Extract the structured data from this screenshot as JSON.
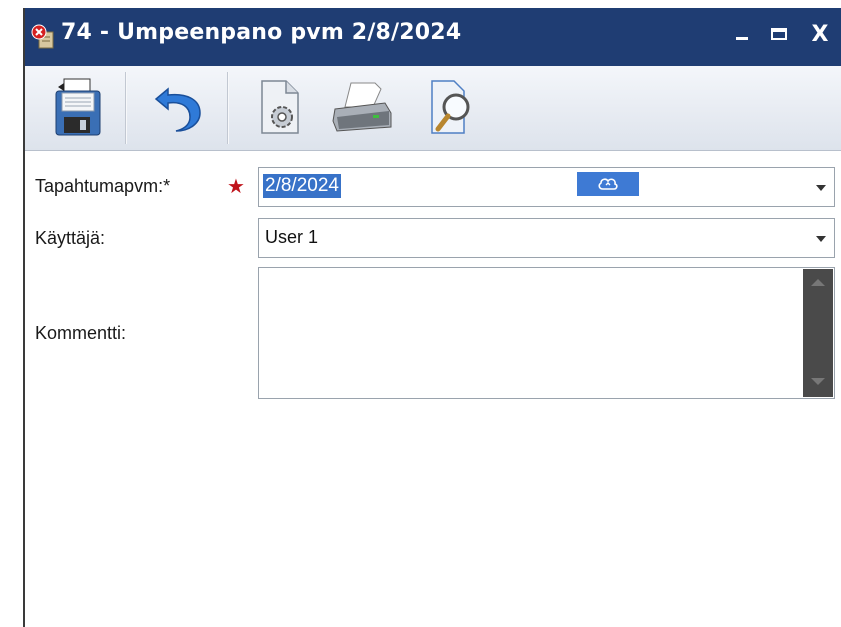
{
  "window": {
    "title": "74 - Umpeenpano pvm 2/8/2024",
    "minimize_icon": "minimize-icon",
    "maximize_icon": "maximize-icon",
    "close_label": "X"
  },
  "toolbar": {
    "buttons": [
      {
        "name": "save-button",
        "icon": "save-icon"
      },
      {
        "name": "undo-button",
        "icon": "undo-icon"
      },
      {
        "name": "settings-button",
        "icon": "document-gear-icon"
      },
      {
        "name": "print-button",
        "icon": "printer-icon"
      },
      {
        "name": "preview-button",
        "icon": "magnifier-document-icon"
      }
    ]
  },
  "form": {
    "date_label": "Tapahtumapvm:*",
    "required_marker": "★",
    "date_value": "2/8/2024",
    "user_label": "Käyttäjä:",
    "user_value": "User 1",
    "comment_label": "Kommentti:",
    "comment_value": ""
  },
  "colors": {
    "titlebar": "#1f3d73",
    "selection": "#3872c8",
    "required": "#c0141c"
  }
}
